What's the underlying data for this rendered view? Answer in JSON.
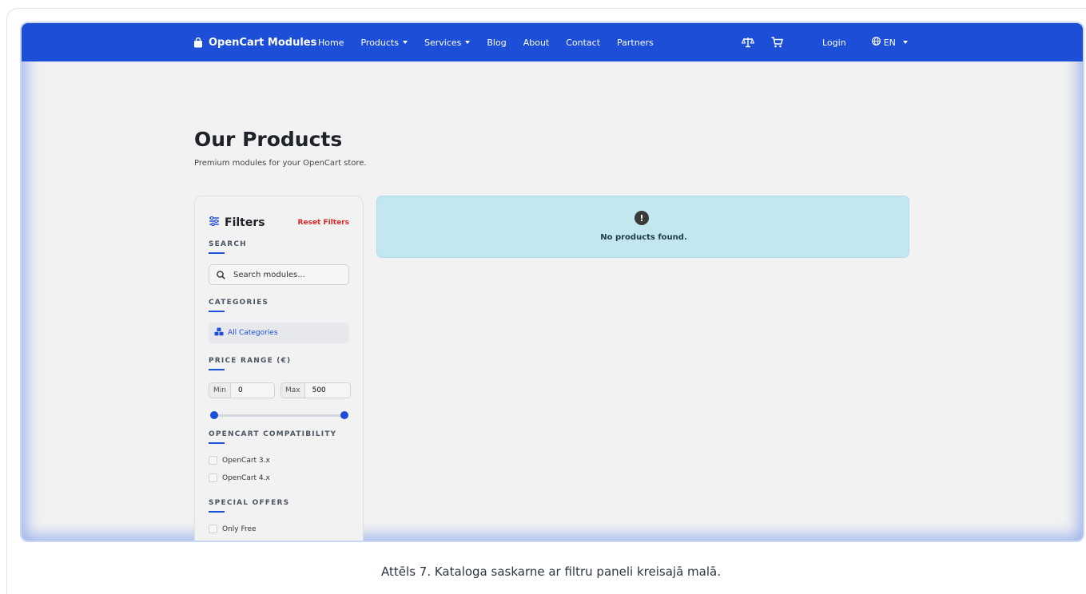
{
  "nav": {
    "brand": "OpenCart Modules",
    "links": [
      {
        "label": "Home"
      },
      {
        "label": "Products"
      },
      {
        "label": "Services"
      },
      {
        "label": "Blog"
      },
      {
        "label": "About"
      },
      {
        "label": "Contact"
      },
      {
        "label": "Partners"
      }
    ],
    "compare_icon": "scale-icon",
    "cart_icon": "cart-icon",
    "login": "Login",
    "language": "EN",
    "language_icon": "globe-icon",
    "brand_icon": "shopping-bag-icon",
    "background_color": "#1d4ed8"
  },
  "page": {
    "title": "Our Products",
    "subtitle": "Premium modules for your OpenCart store."
  },
  "filters": {
    "title": "Filters",
    "title_icon": "sliders-icon",
    "reset_label": "Reset Filters",
    "search_title": "SEARCH",
    "search_placeholder": "Search modules...",
    "categories_title": "CATEGORIES",
    "all_categories": "All Categories",
    "category_icon": "cubes-icon",
    "price_title": "PRICE RANGE (€)",
    "min_label": "Min",
    "min_value": "0",
    "max_label": "Max",
    "max_value": "500",
    "compat_title": "OPENCART COMPATIBILITY",
    "compat_options": [
      "OpenCart 3.x",
      "OpenCart 4.x"
    ],
    "offers_title": "SPECIAL OFFERS",
    "offers_options": [
      "Only Free"
    ],
    "accent_color": "#1d4ed8",
    "reset_color": "#dc2626"
  },
  "results": {
    "empty_message": "No products found.",
    "alert_icon": "exclamation-circle-icon",
    "alert_color": "#c3e7ef"
  },
  "caption": "Attēls 7. Kataloga saskarne ar filtru paneli kreisajā malā."
}
